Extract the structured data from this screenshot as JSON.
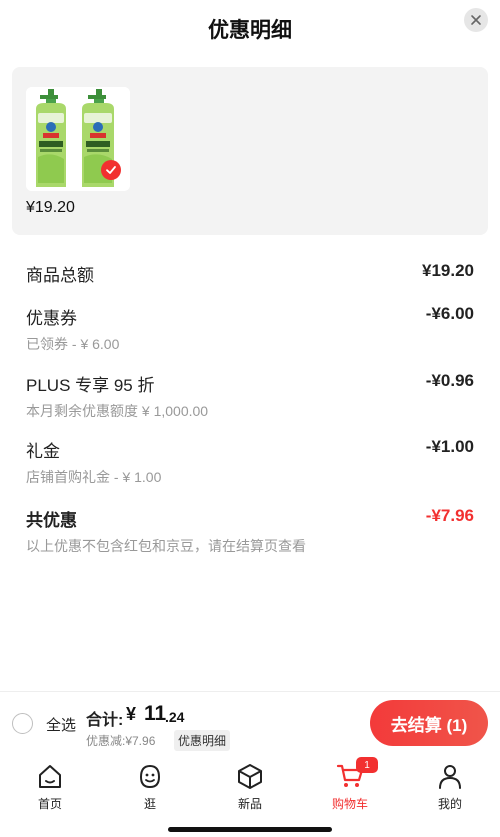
{
  "sheet": {
    "title": "优惠明细"
  },
  "product": {
    "price": "¥19.20",
    "thumbnail_label": "活氧去油"
  },
  "breakdown": {
    "goods_total": {
      "label": "商品总额",
      "amount": "¥19.20"
    },
    "coupon": {
      "label": "优惠券",
      "amount": "-¥6.00",
      "sub": "已领券 - ¥ 6.00"
    },
    "plus": {
      "label": "PLUS 专享 95 折",
      "amount": "-¥0.96",
      "sub": "本月剩余优惠额度 ¥ 1,000.00"
    },
    "gift": {
      "label": "礼金",
      "amount": "-¥1.00",
      "sub": "店铺首购礼金 - ¥ 1.00"
    },
    "total_discount": {
      "label": "共优惠",
      "amount": "-¥7.96",
      "sub": "以上优惠不包含红包和京豆，请在结算页查看"
    }
  },
  "footer": {
    "select_all": "全选",
    "total_label": "合计:",
    "total_yen": "¥",
    "total_int": "11",
    "total_dec": ".24",
    "discount_summary": "优惠减:¥7.96",
    "detail_link": "优惠明细",
    "checkout": "去结算 (1)"
  },
  "tabs": [
    {
      "label": "首页",
      "icon": "home-icon"
    },
    {
      "label": "逛",
      "icon": "stroll-face-icon"
    },
    {
      "label": "新品",
      "icon": "box-icon"
    },
    {
      "label": "购物车",
      "icon": "cart-icon",
      "active": true,
      "badge": "1"
    },
    {
      "label": "我的",
      "icon": "user-icon"
    }
  ],
  "colors": {
    "accent": "#f23030",
    "muted": "#999999",
    "card_bg": "#f3f3f3"
  }
}
